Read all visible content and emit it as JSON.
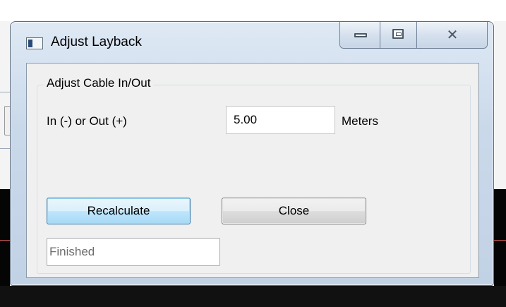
{
  "window": {
    "title": "Adjust Layback",
    "close_glyph": "✕"
  },
  "group": {
    "legend": "Adjust Cable In/Out",
    "field_label": "In (-) or Out (+)",
    "value": "5.00",
    "unit": "Meters"
  },
  "buttons": {
    "recalculate": "Recalculate",
    "close": "Close"
  },
  "status": {
    "text": "Finished"
  },
  "colors": {
    "accent_button": "#bee6fd",
    "frame": "#c8d7e8",
    "client_bg": "#f0f0f0"
  },
  "icons": {
    "app": "window-app-icon",
    "minimize": "minimize-icon",
    "maximize": "maximize-icon",
    "close": "close-icon"
  }
}
